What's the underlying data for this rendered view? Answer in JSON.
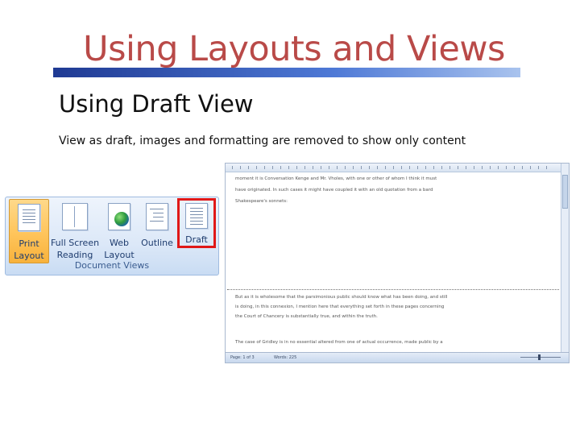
{
  "slide": {
    "title": "Using Layouts and Views",
    "subtitle": "Using Draft View",
    "body": "View as draft, images and formatting are removed to show only content"
  },
  "ribbon": {
    "group_label": "Document Views",
    "buttons": [
      {
        "label_1": "Print",
        "label_2": "Layout",
        "icon": "print-layout-icon",
        "state": "active"
      },
      {
        "label_1": "Full Screen",
        "label_2": "Reading",
        "icon": "full-screen-reading-icon",
        "state": "normal"
      },
      {
        "label_1": "Web",
        "label_2": "Layout",
        "icon": "web-layout-icon",
        "state": "normal"
      },
      {
        "label_1": "Outline",
        "label_2": "",
        "icon": "outline-icon",
        "state": "normal"
      },
      {
        "label_1": "Draft",
        "label_2": "",
        "icon": "draft-icon",
        "state": "highlighted"
      }
    ]
  },
  "document": {
    "lines_top": [
      "moment it is Conversation Kenge and Mr. Vholes, with one or other of whom I think it must",
      "have originated. In such cases it might have coupled it with an old quotation from a bard",
      "Shakespeare's sonnets:"
    ],
    "lines_bottom": [
      "But as it is wholesome that the parsimonious public should know what has been doing, and still",
      "is doing, in this connexion, I mention here that everything set forth in these pages concerning",
      "the Court of Chancery is substantially true, and within the truth.",
      "",
      "The case of Gridley is in no essential altered from one of actual occurrence, made public by a"
    ],
    "status": {
      "page": "Page: 1 of 3",
      "words": "Words: 225"
    }
  },
  "colors": {
    "title": "#b94a48",
    "highlight": "#e01818",
    "active_button": "#ffc45a"
  }
}
